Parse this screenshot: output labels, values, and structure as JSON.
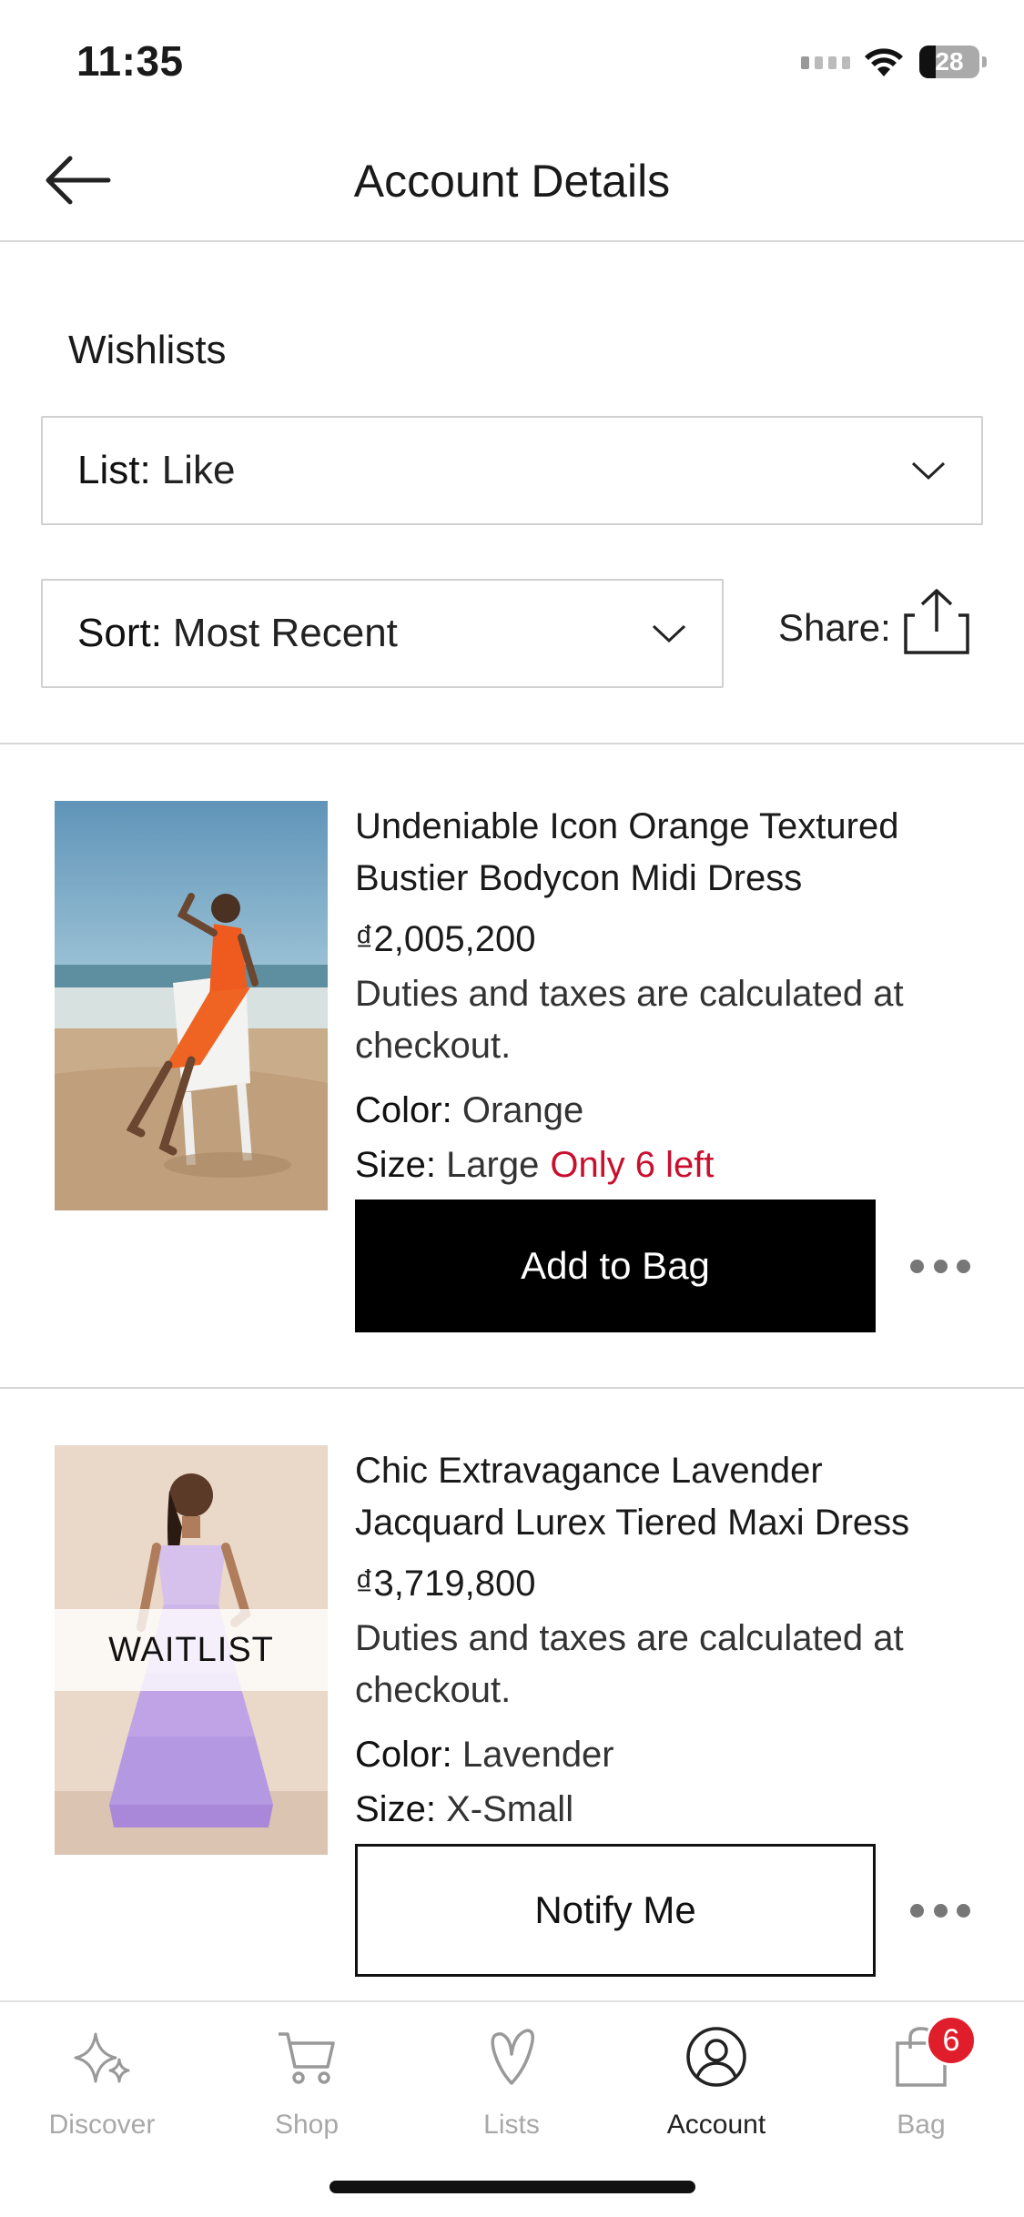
{
  "status": {
    "time": "11:35",
    "battery": "28"
  },
  "header": {
    "title": "Account Details"
  },
  "wishlists": {
    "title": "Wishlists",
    "list_key": "List:",
    "list_value": "Like",
    "sort_key": "Sort:",
    "sort_value": "Most Recent",
    "share_label": "Share:"
  },
  "products": [
    {
      "name": "Undeniable Icon Orange Textured Bustier Bodycon Midi Dress",
      "price": "₫2,005,200",
      "note": "Duties and taxes are calculated at checkout.",
      "color_key": "Color:",
      "color": "Orange",
      "size_key": "Size:",
      "size": "Large",
      "stock_alert": "Only 6 left",
      "action": "Add to Bag"
    },
    {
      "name": "Chic Extravagance Lavender Jacquard Lurex Tiered Maxi Dress",
      "price": "₫3,719,800",
      "note": "Duties and taxes are calculated at checkout.",
      "color_key": "Color:",
      "color": "Lavender",
      "size_key": "Size:",
      "size": "X-Small",
      "overlay": "WAITLIST",
      "action": "Notify Me"
    }
  ],
  "tabs": [
    {
      "label": "Discover",
      "icon": "sparkle-icon"
    },
    {
      "label": "Shop",
      "icon": "cart-icon"
    },
    {
      "label": "Lists",
      "icon": "heart-v-icon"
    },
    {
      "label": "Account",
      "icon": "user-circle-icon",
      "active": true
    },
    {
      "label": "Bag",
      "icon": "bag-icon",
      "badge": "6"
    }
  ],
  "colors": {
    "accent_red": "#c8102e",
    "badge_red": "#e01e2b",
    "primary": "#000000"
  }
}
